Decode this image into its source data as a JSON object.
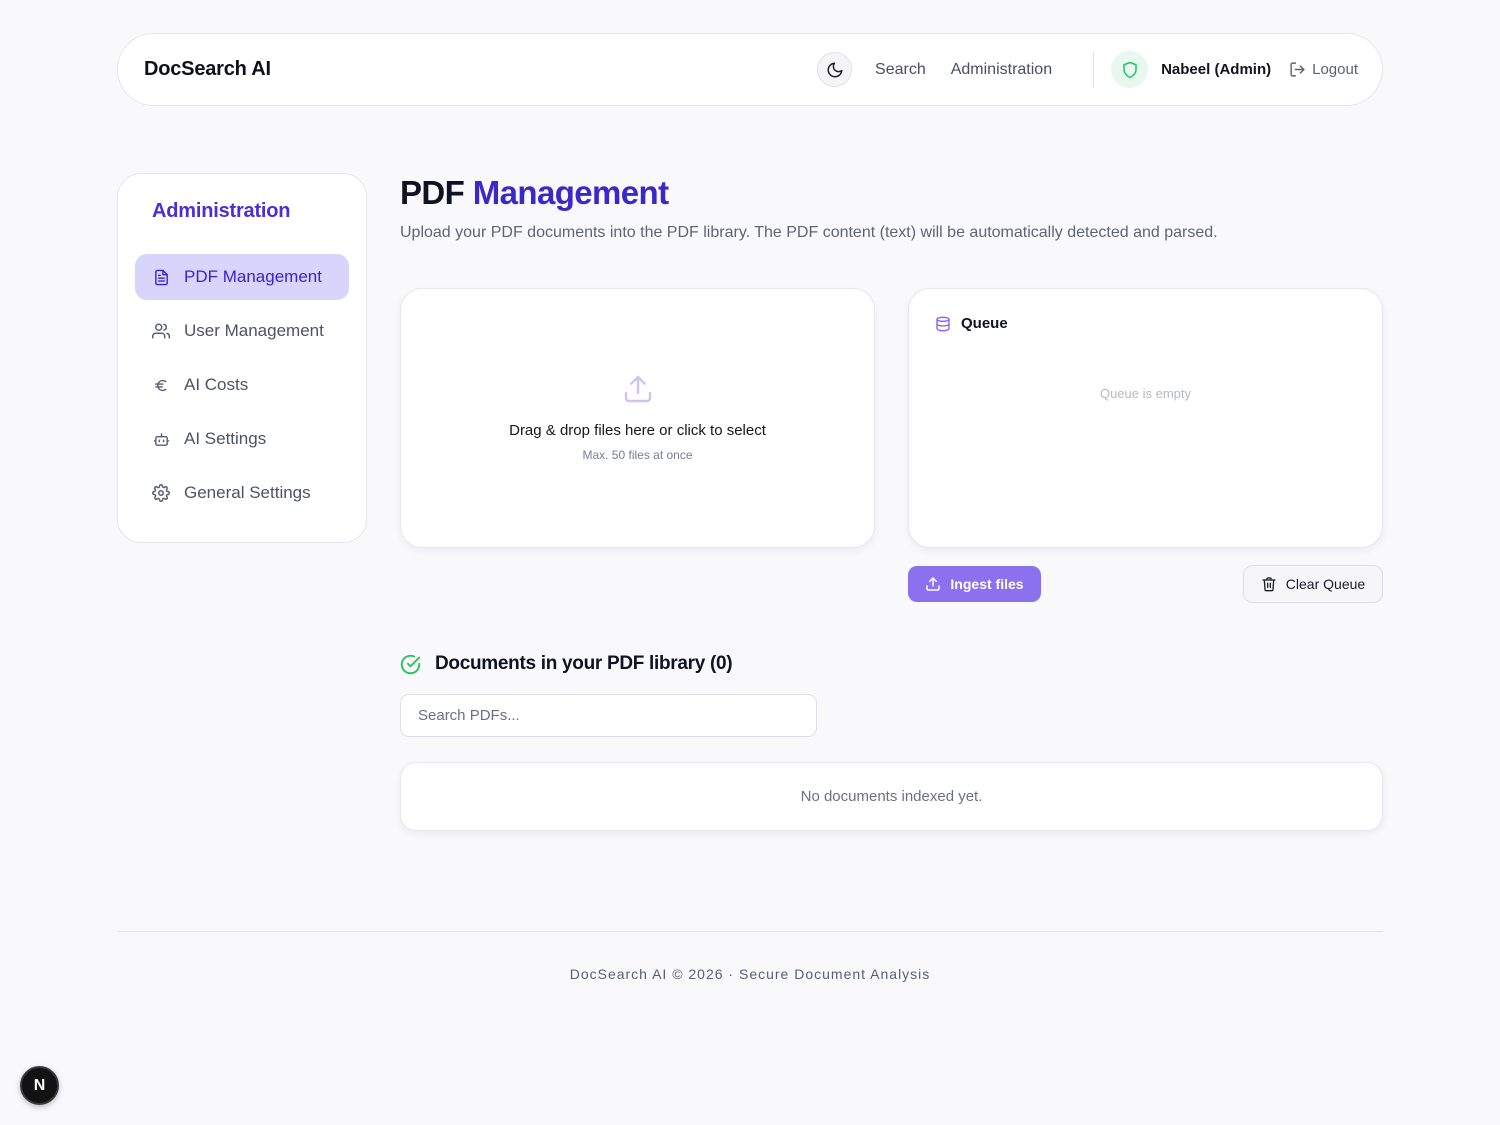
{
  "header": {
    "brand": "DocSearch AI",
    "nav": {
      "search": "Search",
      "administration": "Administration"
    },
    "user_name": "Nabeel (Admin)",
    "logout": "Logout",
    "icons": {
      "theme": "moon-icon",
      "role": "shield-icon",
      "logout": "logout-icon"
    }
  },
  "sidebar": {
    "title": "Administration",
    "items": [
      {
        "label": "PDF Management",
        "icon": "file-text-icon",
        "active": true
      },
      {
        "label": "User Management",
        "icon": "users-icon",
        "active": false
      },
      {
        "label": "AI Costs",
        "icon": "euro-icon",
        "active": false
      },
      {
        "label": "AI Settings",
        "icon": "robot-icon",
        "active": false
      },
      {
        "label": "General Settings",
        "icon": "gear-icon",
        "active": false
      }
    ]
  },
  "main": {
    "title_part1": "PDF",
    "title_part2": "Management",
    "subtitle": "Upload your PDF documents into the PDF library. The PDF content (text) will be automatically detected and parsed.",
    "dropzone": {
      "text": "Drag & drop files here or click to select",
      "hint": "Max. 50 files at once"
    },
    "queue": {
      "title": "Queue",
      "empty": "Queue is empty"
    },
    "buttons": {
      "ingest": "Ingest files",
      "clear": "Clear Queue"
    },
    "library": {
      "title": "Documents in your PDF library (0)",
      "search_placeholder": "Search PDFs...",
      "empty": "No documents indexed yet."
    }
  },
  "footer": {
    "text": "DocSearch AI © 2026 · Secure Document Analysis"
  },
  "badge": {
    "label": "N"
  },
  "colors": {
    "accent": "#3c28c8",
    "active_bg": "#d9d4fb",
    "ingest": "#8c71ee",
    "success": "#22c55e"
  }
}
